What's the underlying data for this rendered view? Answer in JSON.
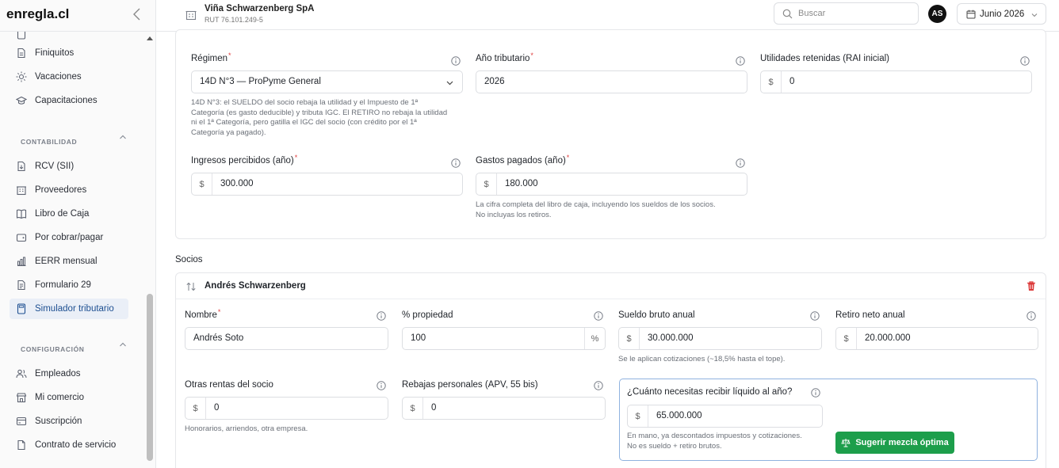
{
  "brand": "enregla.cl",
  "sidebar": {
    "items_top": [
      {
        "label": "Finiquitos",
        "icon": "document-icon"
      },
      {
        "label": "Vacaciones",
        "icon": "sun-icon"
      },
      {
        "label": "Capacitaciones",
        "icon": "graduation-cap-icon"
      }
    ],
    "section_contabilidad": "CONTABILIDAD",
    "items_contabilidad": [
      {
        "label": "RCV (SII)",
        "icon": "receipt-icon"
      },
      {
        "label": "Proveedores",
        "icon": "building-icon"
      },
      {
        "label": "Libro de Caja",
        "icon": "book-icon"
      },
      {
        "label": "Por cobrar/pagar",
        "icon": "wallet-icon"
      },
      {
        "label": "EERR mensual",
        "icon": "bar-chart-icon"
      },
      {
        "label": "Formulario 29",
        "icon": "form-icon"
      },
      {
        "label": "Simulador tributario",
        "icon": "calculator-icon",
        "active": true
      }
    ],
    "section_configuracion": "CONFIGURACIÓN",
    "items_configuracion": [
      {
        "label": "Empleados",
        "icon": "users-icon"
      },
      {
        "label": "Mi comercio",
        "icon": "store-icon"
      },
      {
        "label": "Suscripción",
        "icon": "card-icon"
      },
      {
        "label": "Contrato de servicio",
        "icon": "contract-icon"
      }
    ]
  },
  "header": {
    "company_name": "Viña Schwarzenberg SpA",
    "company_rut": "RUT 76.101.249-5",
    "search_placeholder": "Buscar",
    "avatar_initials": "AS",
    "period": "Junio 2026"
  },
  "form": {
    "regimen_label": "Régimen",
    "regimen_value": "14D N°3 — ProPyme General",
    "regimen_help": [
      "14D N°3: el SUELDO del socio rebaja la utilidad y el Impuesto de 1ª",
      "Categoría (es gasto deducible) y tributa IGC. El RETIRO no rebaja la utilidad",
      "ni el 1ª Categoría, pero gatilla el IGC del socio (con crédito por el 1ª",
      "Categoría ya pagado)."
    ],
    "anio_label": "Año tributario",
    "anio_value": "2026",
    "utilidades_label": "Utilidades retenidas (RAI inicial)",
    "utilidades_value": "0",
    "ingresos_label": "Ingresos percibidos (año)",
    "ingresos_value": "300.000",
    "gastos_label": "Gastos pagados (año)",
    "gastos_value": "180.000",
    "gastos_help": [
      "La cifra completa del libro de caja, incluyendo los sueldos de los socios.",
      "No incluyas los retiros."
    ],
    "currency": "$"
  },
  "socios": {
    "title": "Socios",
    "socio": {
      "header_name": "Andrés Schwarzenberg",
      "nombre_label": "Nombre",
      "nombre_value": "Andrés Soto",
      "propiedad_label": "% propiedad",
      "propiedad_value": "100",
      "propiedad_suffix": "%",
      "sueldo_label": "Sueldo bruto anual",
      "sueldo_value": "30.000.000",
      "sueldo_help": "Se le aplican cotizaciones (~18,5% hasta el tope).",
      "retiro_label": "Retiro neto anual",
      "retiro_value": "20.000.000",
      "otras_label": "Otras rentas del socio",
      "otras_value": "0",
      "otras_help": "Honorarios, arriendos, otra empresa.",
      "rebajas_label": "Rebajas personales (APV, 55 bis)",
      "rebajas_value": "0",
      "liquido_label": "¿Cuánto necesitas recibir líquido al año?",
      "liquido_value": "65.000.000",
      "liquido_help": [
        "En mano, ya descontados impuestos y cotizaciones.",
        "No es sueldo + retiro brutos."
      ],
      "suggest_label": "Sugerir mezcla óptima"
    }
  },
  "colors": {
    "accent": "#1d4f91",
    "success": "#1d9e4b",
    "danger": "#dc3a3a",
    "required": "#e03e3e"
  }
}
